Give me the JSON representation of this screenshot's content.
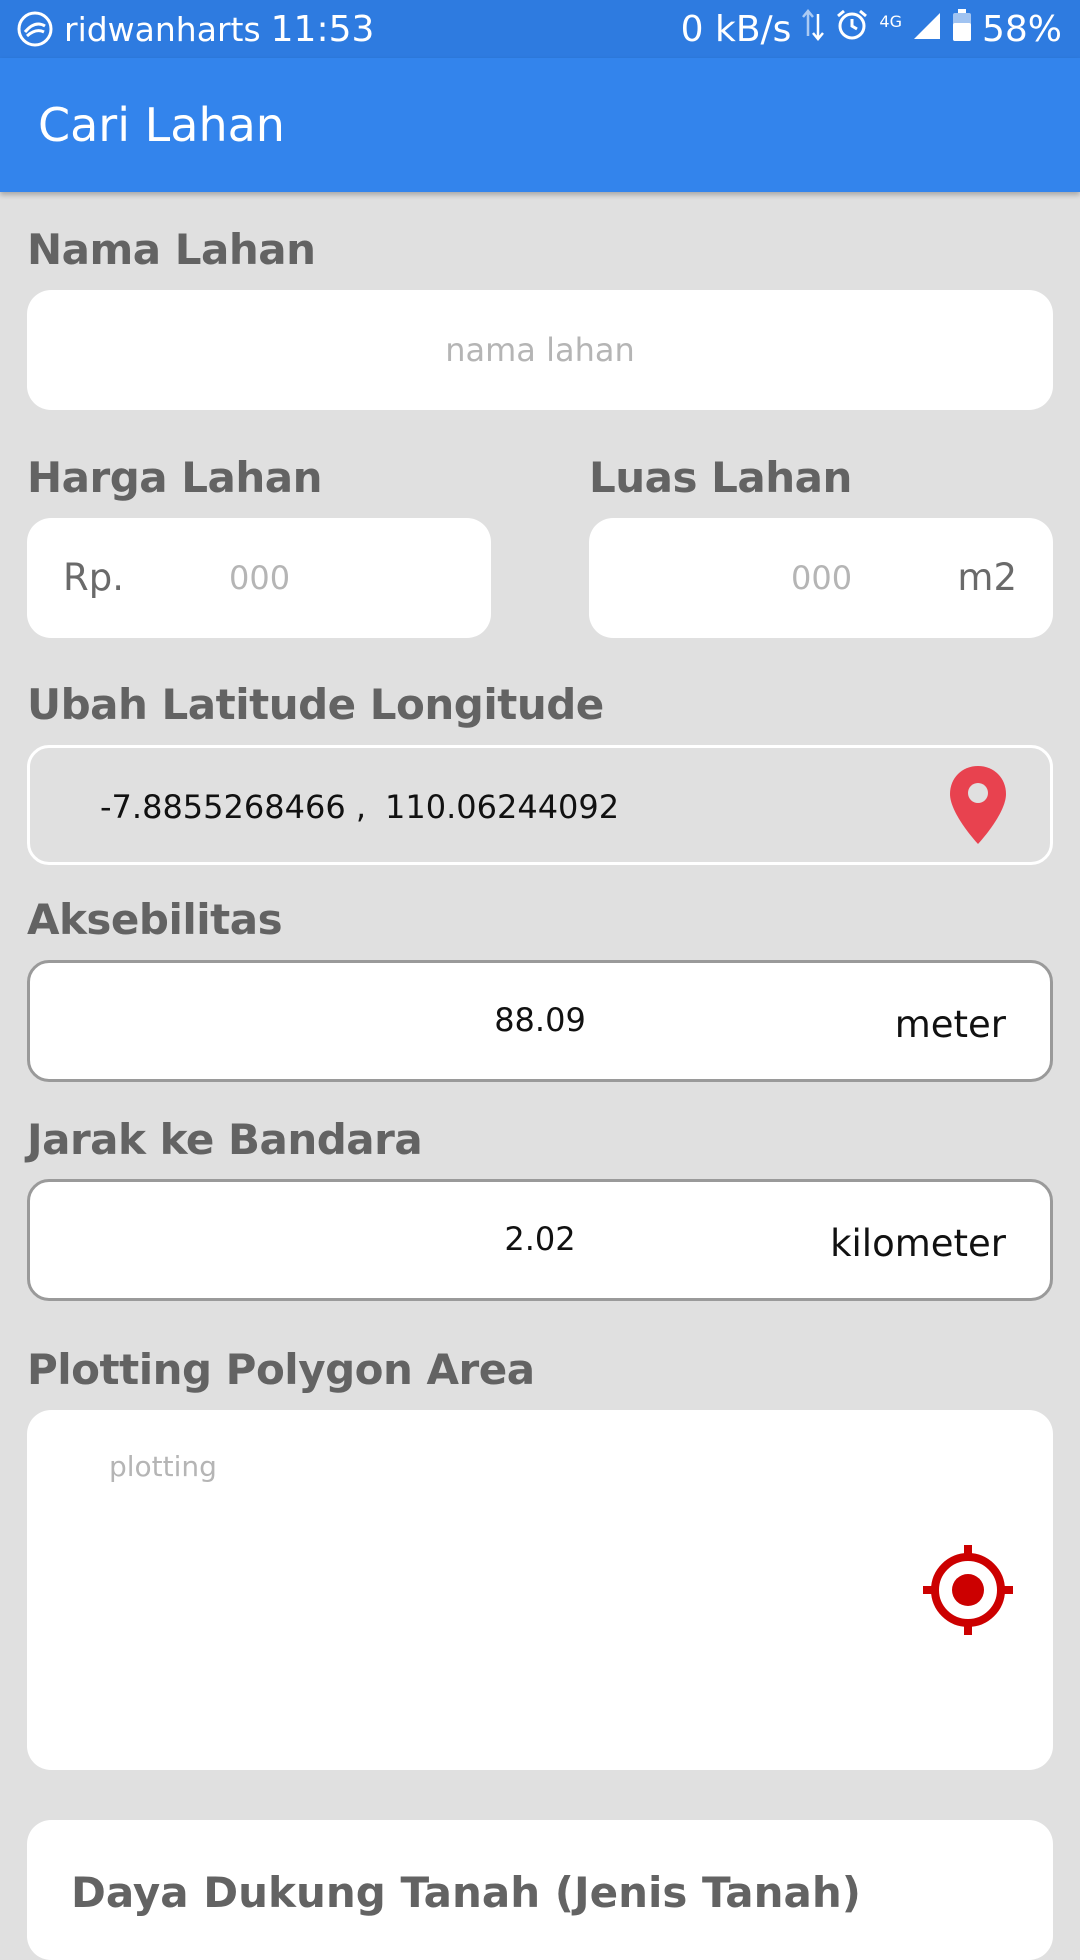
{
  "status_bar": {
    "carrier": "ridwanharts",
    "time": "11:53",
    "net_speed": "0 kB/s",
    "network_type": "4G",
    "battery": "58%",
    "icons": [
      "app-logo-icon",
      "data-arrows-icon",
      "alarm-icon",
      "signal-icon",
      "battery-icon"
    ]
  },
  "app_bar": {
    "title": "Cari Lahan"
  },
  "form": {
    "nama_lahan": {
      "label": "Nama Lahan",
      "placeholder": "nama lahan"
    },
    "harga_lahan": {
      "label": "Harga Lahan",
      "prefix": "Rp.",
      "placeholder": "000"
    },
    "luas_lahan": {
      "label": "Luas Lahan",
      "placeholder": "000",
      "unit": "m2"
    },
    "lat_long": {
      "label": "Ubah Latitude Longitude",
      "latitude": "-7.8855268466 ,",
      "longitude": "110.06244092",
      "icon": "map-pin-icon"
    },
    "aksebilitas": {
      "label": "Aksebilitas",
      "value": "88.09",
      "unit": "meter"
    },
    "jarak_bandara": {
      "label": "Jarak ke Bandara",
      "value": "2.02",
      "unit": "kilometer"
    },
    "plotting": {
      "label": "Plotting Polygon Area",
      "placeholder": "plotting",
      "icon": "target-icon"
    },
    "daya_dukung": {
      "title": "Daya Dukung Tanah (Jenis Tanah)"
    }
  },
  "colors": {
    "status_bar": "#2e7be0",
    "app_bar": "#3384ec",
    "background": "#e0e0e0",
    "pin": "#e8424f",
    "target": "#cc0000"
  }
}
